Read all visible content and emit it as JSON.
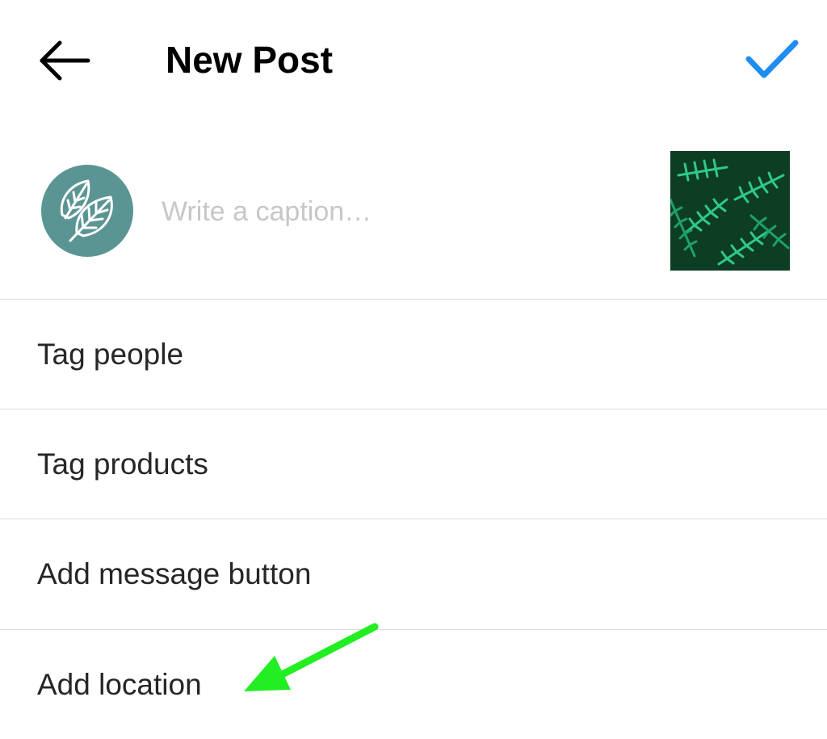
{
  "header": {
    "title": "New Post",
    "back_icon": "arrow-left-icon",
    "confirm_icon": "checkmark-icon"
  },
  "caption": {
    "placeholder": "Write a caption…",
    "value": ""
  },
  "menu": {
    "items": [
      {
        "label": "Tag people"
      },
      {
        "label": "Tag products"
      },
      {
        "label": "Add message button"
      },
      {
        "label": "Add location"
      }
    ]
  },
  "colors": {
    "accent": "#1f8cf0",
    "avatar_bg": "#5a9593",
    "annotation_arrow": "#22ee22",
    "divider": "#dbdbdb",
    "placeholder": "#c7c7c7"
  }
}
